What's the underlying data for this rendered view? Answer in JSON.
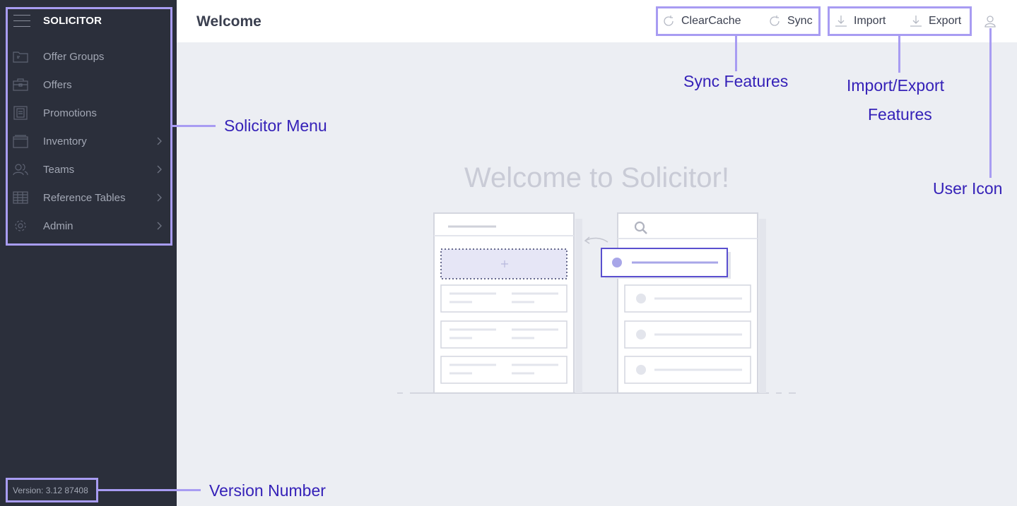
{
  "sidebar": {
    "brand": "SOLICITOR",
    "items": [
      {
        "label": "Offer Groups",
        "icon": "folder-icon",
        "has_children": false
      },
      {
        "label": "Offers",
        "icon": "briefcase-icon",
        "has_children": false
      },
      {
        "label": "Promotions",
        "icon": "clipboard-icon",
        "has_children": false
      },
      {
        "label": "Inventory",
        "icon": "inventory-box-icon",
        "has_children": true
      },
      {
        "label": "Teams",
        "icon": "users-icon",
        "has_children": true
      },
      {
        "label": "Reference Tables",
        "icon": "table-icon",
        "has_children": true
      },
      {
        "label": "Admin",
        "icon": "gear-icon",
        "has_children": true
      }
    ],
    "version": "Version: 3.12 87408"
  },
  "header": {
    "title": "Welcome",
    "clear_cache_label": "ClearCache",
    "sync_label": "Sync",
    "import_label": "Import",
    "export_label": "Export"
  },
  "main": {
    "welcome_text": "Welcome to Solicitor!"
  },
  "annotations": {
    "solicitor_menu": "Solicitor Menu",
    "version_number": "Version Number",
    "sync_features": "Sync Features",
    "import_export_line1": "Import/Export",
    "import_export_line2": "Features",
    "user_icon": "User Icon"
  },
  "colors": {
    "sidebar_bg": "#2b2f3b",
    "main_bg": "#eceef3",
    "annotation_stroke": "#a89cf2",
    "annotation_text": "#3521b8"
  }
}
